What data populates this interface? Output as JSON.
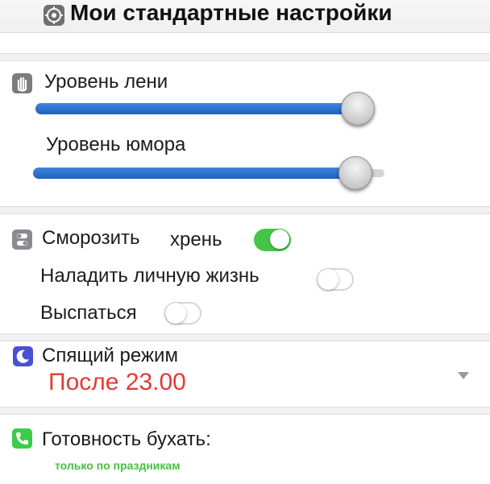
{
  "header": {
    "title": "Мои стандартные настройки",
    "icon": "gear-icon"
  },
  "sliders": [
    {
      "label": "Уровень лени",
      "icon": "hand-icon",
      "level": 0.93
    },
    {
      "label": "Уровень юмора",
      "level": 0.93
    }
  ],
  "toggles": [
    {
      "label": "Сморозить",
      "label_extra": "хрень",
      "icon": "mixer-icon",
      "state": "on"
    },
    {
      "label": "Наладить личную жизнь",
      "state": "off"
    },
    {
      "label": "Выспаться",
      "state": "off"
    }
  ],
  "sleep_mode": {
    "label": "Спящий режим",
    "icon": "moon-icon",
    "value": "После 23.00"
  },
  "drink_ready": {
    "label": "Готовность бухать:",
    "icon": "phone-icon",
    "value": "только по праздникам"
  },
  "colors": {
    "toggle_on": "#45c548",
    "slider_fill": "#2a6fd0",
    "value_red": "#e53a36",
    "note_green": "#47c03e"
  }
}
